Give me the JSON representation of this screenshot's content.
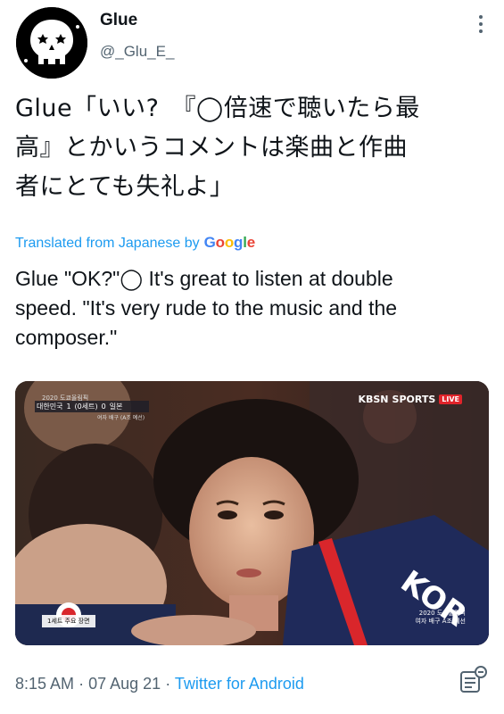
{
  "tweet": {
    "display_name": "Glue",
    "handle": "@_Glu_E_",
    "text_lines": [
      "Glue「いい?　『◯倍速で聴いたら最",
      "高』とかいうコメントは楽曲と作曲",
      "者にとても失礼よ」"
    ],
    "translated_label": "Translated from Japanese by",
    "translated_provider": "Google",
    "translation_lines": [
      "Glue \"OK?\"◯ It's great to listen at double",
      "speed. \"It's very rude to the music and the",
      "composer.\""
    ],
    "time": "8:15 AM",
    "separator": "·",
    "date": "07 Aug 21",
    "source": "Twitter for Android"
  },
  "media": {
    "score_header": "2020 도쿄올림픽",
    "team_left": "대한민국",
    "score_left": "1",
    "score_middle": "(0세트)",
    "score_right": "0",
    "team_right": "일본",
    "score_sub": "여자 배구 (A조 예선)",
    "broadcaster_name": "KBSN",
    "broadcaster_sports": "SPORTS",
    "broadcaster_live": "LIVE",
    "caption": "1세트 주요 장면",
    "olympic_lines": [
      "2020 도쿄올림픽",
      "여자 배구 A조 예선"
    ]
  },
  "colors": {
    "link": "#1d9bf0",
    "muted": "#536471",
    "live": "#e0242b"
  },
  "icons": {
    "avatar": "skull-avatar",
    "more": "more-vertical-icon",
    "google": "google-logo",
    "meta": "tweet-analytics-icon"
  }
}
